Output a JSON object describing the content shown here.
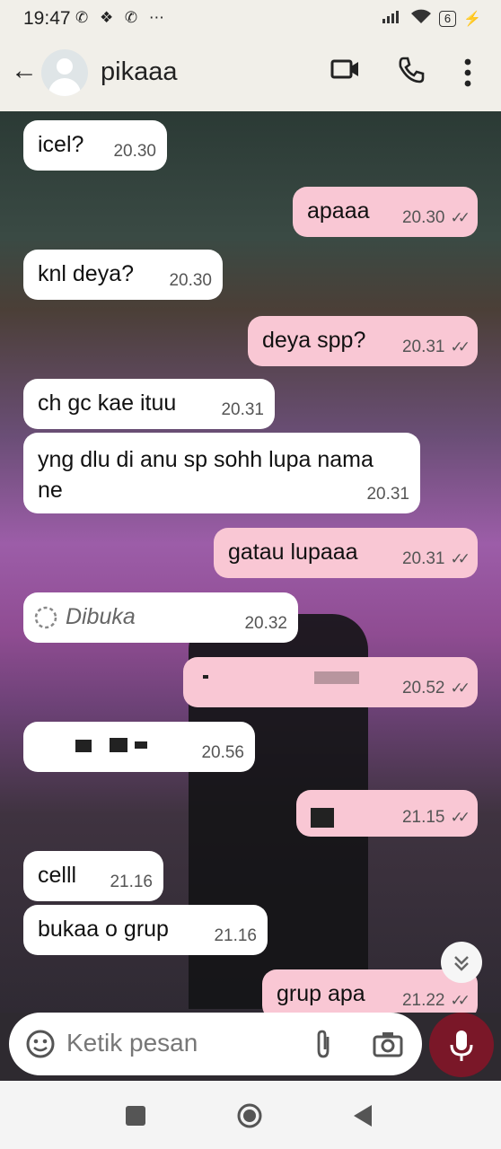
{
  "status_bar": {
    "time": "19:47",
    "app_icons": "✆ ❖ ✆ ⋯",
    "battery": "6"
  },
  "header": {
    "contact_name": "pikaaa"
  },
  "messages": [
    {
      "dir": "in",
      "text": "icel?",
      "time": "20.30"
    },
    {
      "dir": "out",
      "text": "apaaa",
      "time": "20.30",
      "ticks": "✓✓"
    },
    {
      "dir": "in",
      "text": "knl deya?",
      "time": "20.30"
    },
    {
      "dir": "out",
      "text": "deya spp?",
      "time": "20.31",
      "ticks": "✓✓"
    },
    {
      "dir": "in",
      "text": "ch gc kae ituu",
      "time": "20.31"
    },
    {
      "dir": "in",
      "text": "yng dlu di anu sp sohh lupa nama ne",
      "time": "20.31"
    },
    {
      "dir": "out",
      "text": "gatau lupaaa",
      "time": "20.31",
      "ticks": "✓✓"
    },
    {
      "dir": "in",
      "text": "Dibuka",
      "time": "20.32"
    },
    {
      "dir": "out",
      "text": "",
      "time": "20.52",
      "ticks": "✓✓"
    },
    {
      "dir": "in",
      "text": "",
      "time": "20.56"
    },
    {
      "dir": "out",
      "text": "",
      "time": "21.15",
      "ticks": "✓✓"
    },
    {
      "dir": "in",
      "text": "celll",
      "time": "21.16"
    },
    {
      "dir": "in",
      "text": "bukaa o grup",
      "time": "21.16"
    },
    {
      "dir": "out",
      "text": "grup apa",
      "time": "21.22",
      "ticks": "✓✓"
    }
  ],
  "composer": {
    "placeholder": "Ketik pesan"
  },
  "colors": {
    "incoming": "#ffffff",
    "outgoing": "#f9c7d4",
    "mic": "#7a1728"
  }
}
